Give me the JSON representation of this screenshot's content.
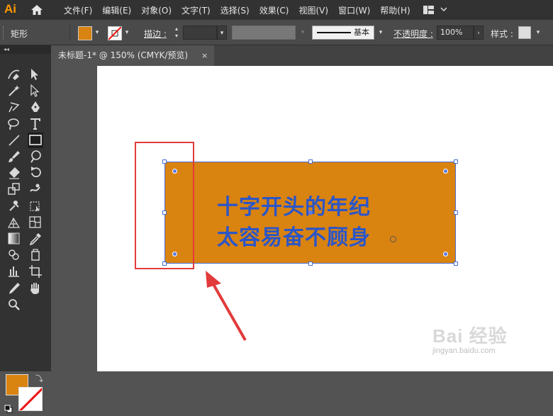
{
  "app": {
    "logo": "Ai"
  },
  "menu": [
    "文件(F)",
    "编辑(E)",
    "对象(O)",
    "文字(T)",
    "选择(S)",
    "效果(C)",
    "视图(V)",
    "窗口(W)",
    "帮助(H)"
  ],
  "control_bar": {
    "shape_label": "矩形",
    "stroke_label": "描边 :",
    "stroke_style": "基本",
    "opacity_label": "不透明度 :",
    "opacity_value": "100%",
    "style_label": "样式 :"
  },
  "document_tab": {
    "title": "未标题-1* @ 150% (CMYK/预览)",
    "close": "×"
  },
  "toolbox": {
    "collapse": "◂◂"
  },
  "artwork": {
    "line1": "十字开头的年纪",
    "line2": "太容易奋不顾身"
  },
  "watermark": {
    "brand": "Bai 经验",
    "url": "jingyan.baidu.com"
  },
  "colors": {
    "fill": "#d98311",
    "text": "#2b56c8",
    "selection": "#4b6fd6",
    "highlight": "#e23b3b"
  }
}
